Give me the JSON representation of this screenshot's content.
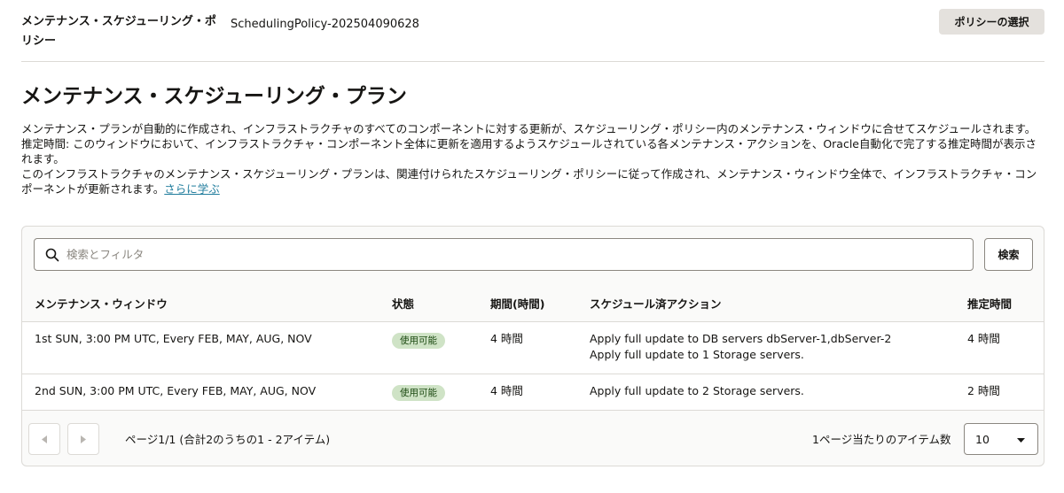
{
  "header": {
    "policy_label": "メンテナンス・スケジューリング・ポリシー",
    "policy_value": "SchedulingPolicy-202504090628",
    "select_policy_label": "ポリシーの選択"
  },
  "main": {
    "title": "メンテナンス・スケジューリング・プラン",
    "description": [
      "メンテナンス・プランが自動的に作成され、インフラストラクチャのすべてのコンポーネントに対する更新が、スケジューリング・ポリシー内のメンテナンス・ウィンドウに合せてスケジュールされます。",
      "推定時間: このウィンドウにおいて、インフラストラクチャ・コンポーネント全体に更新を適用するようスケジュールされている各メンテナンス・アクションを、Oracle自動化で完了する推定時間が表示されます。",
      "このインフラストラクチャのメンテナンス・スケジューリング・プランは、関連付けられたスケジューリング・ポリシーに従って作成され、メンテナンス・ウィンドウ全体で、インフラストラクチャ・コンポーネントが更新されます。"
    ],
    "learn_more": "さらに学ぶ"
  },
  "search": {
    "placeholder": "検索とフィルタ",
    "button_label": "検索"
  },
  "table": {
    "columns": [
      "メンテナンス・ウィンドウ",
      "状態",
      "期間(時間)",
      "スケジュール済アクション",
      "推定時間"
    ],
    "rows": [
      {
        "window": "1st SUN, 3:00 PM UTC, Every FEB, MAY, AUG, NOV",
        "state": "使用可能",
        "duration": "4 時間",
        "actions": [
          "Apply full update to DB servers dbServer-1,dbServer-2",
          "Apply full update to 1 Storage servers."
        ],
        "estimated": "4 時間"
      },
      {
        "window": "2nd SUN, 3:00 PM UTC, Every FEB, MAY, AUG, NOV",
        "state": "使用可能",
        "duration": "4 時間",
        "actions": [
          "Apply full update to 2 Storage servers."
        ],
        "estimated": "2 時間"
      }
    ]
  },
  "pagination": {
    "info": "ページ1/1 (合計2のうちの1 - 2アイテム)",
    "per_page_label": "1ページ当たりのアイテム数",
    "per_page_value": "10"
  },
  "colors": {
    "badge_bg": "#cfe3c6",
    "link": "#227e9e",
    "button_bg": "#e4e1dd"
  },
  "icons": [
    "search-icon",
    "chevron-left-icon",
    "chevron-right-icon",
    "caret-down-icon"
  ]
}
